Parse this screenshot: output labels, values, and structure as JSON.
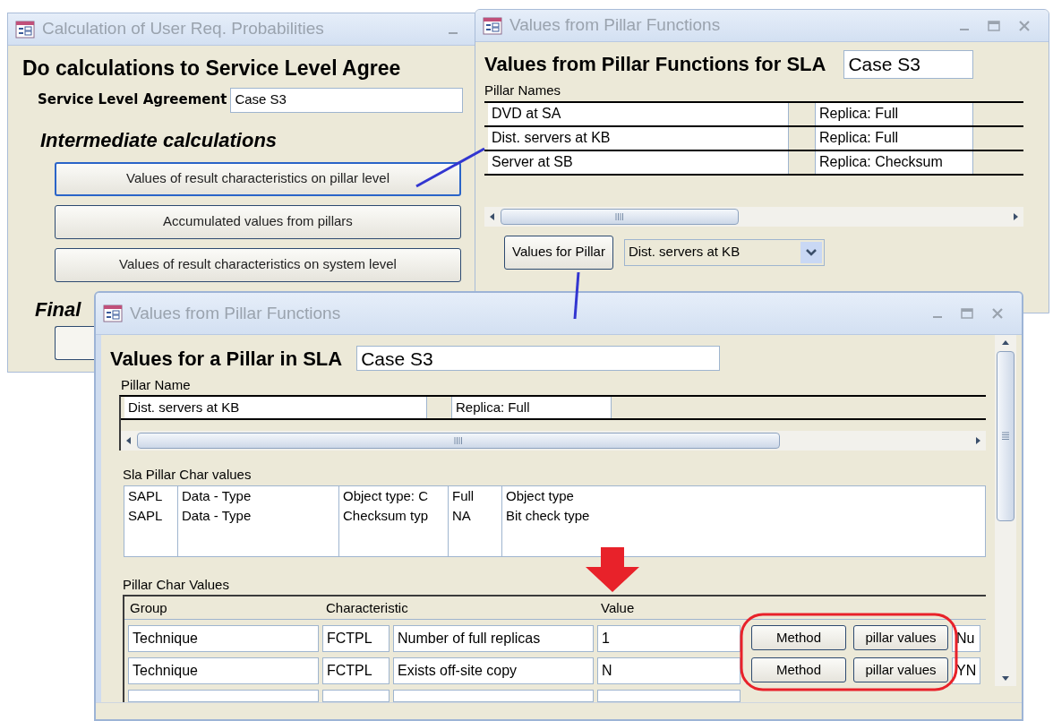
{
  "calc_window": {
    "title": "Calculation of User Req. Probabilities",
    "heading": "Do calculations to Service Level Agree",
    "sla_label": "Service Level Agreement",
    "sla_value": "Case S3",
    "intermediate_heading": "Intermediate calculations",
    "buttons": [
      {
        "label": "Values of result characteristics on pillar level",
        "focused": true
      },
      {
        "label": "Accumulated values from pillars",
        "focused": false
      },
      {
        "label": "Values of result characteristics on system level",
        "focused": false
      }
    ],
    "final_heading": "Final"
  },
  "sla_window": {
    "title": "Values from Pillar Functions",
    "heading": "Values from Pillar Functions for SLA",
    "case_value": "Case S3",
    "list_label": "Pillar Names",
    "rows": [
      {
        "name": "DVD at SA",
        "replica": "Replica: Full"
      },
      {
        "name": "Dist. servers at KB",
        "replica": "Replica: Full"
      },
      {
        "name": "Server at SB",
        "replica": "Replica: Checksum"
      }
    ],
    "pillar_button": "Values for Pillar",
    "pillar_combo": "Dist. servers at KB"
  },
  "pillar_window": {
    "title": "Values from Pillar Functions",
    "heading": "Values for a Pillar in SLA",
    "case_value": "Case S3",
    "name_label": "Pillar Name",
    "pillar_row": {
      "name": "Dist. servers at KB",
      "replica": "Replica: Full"
    },
    "sla_char_label": "Sla Pillar Char values",
    "sla_char_rows": [
      [
        "SAPL",
        "Data - Type",
        "Object type: C",
        "Full",
        "Object type"
      ],
      [
        "SAPL",
        "Data - Type",
        "Checksum typ",
        "NA",
        "Bit check type"
      ]
    ],
    "char_label": "Pillar Char Values",
    "char_columns": [
      "Group",
      "Characteristic",
      "Value"
    ],
    "char_rows": [
      {
        "group": "Technique",
        "code": "FCTPL",
        "characteristic": "Number of full replicas",
        "value": "1",
        "method_button": "Method",
        "values_button": "pillar values",
        "extra": "Nu"
      },
      {
        "group": "Technique",
        "code": "FCTPL",
        "characteristic": "Exists off-site copy",
        "value": "N",
        "method_button": "Method",
        "values_button": "pillar values",
        "extra": "YN"
      }
    ]
  }
}
